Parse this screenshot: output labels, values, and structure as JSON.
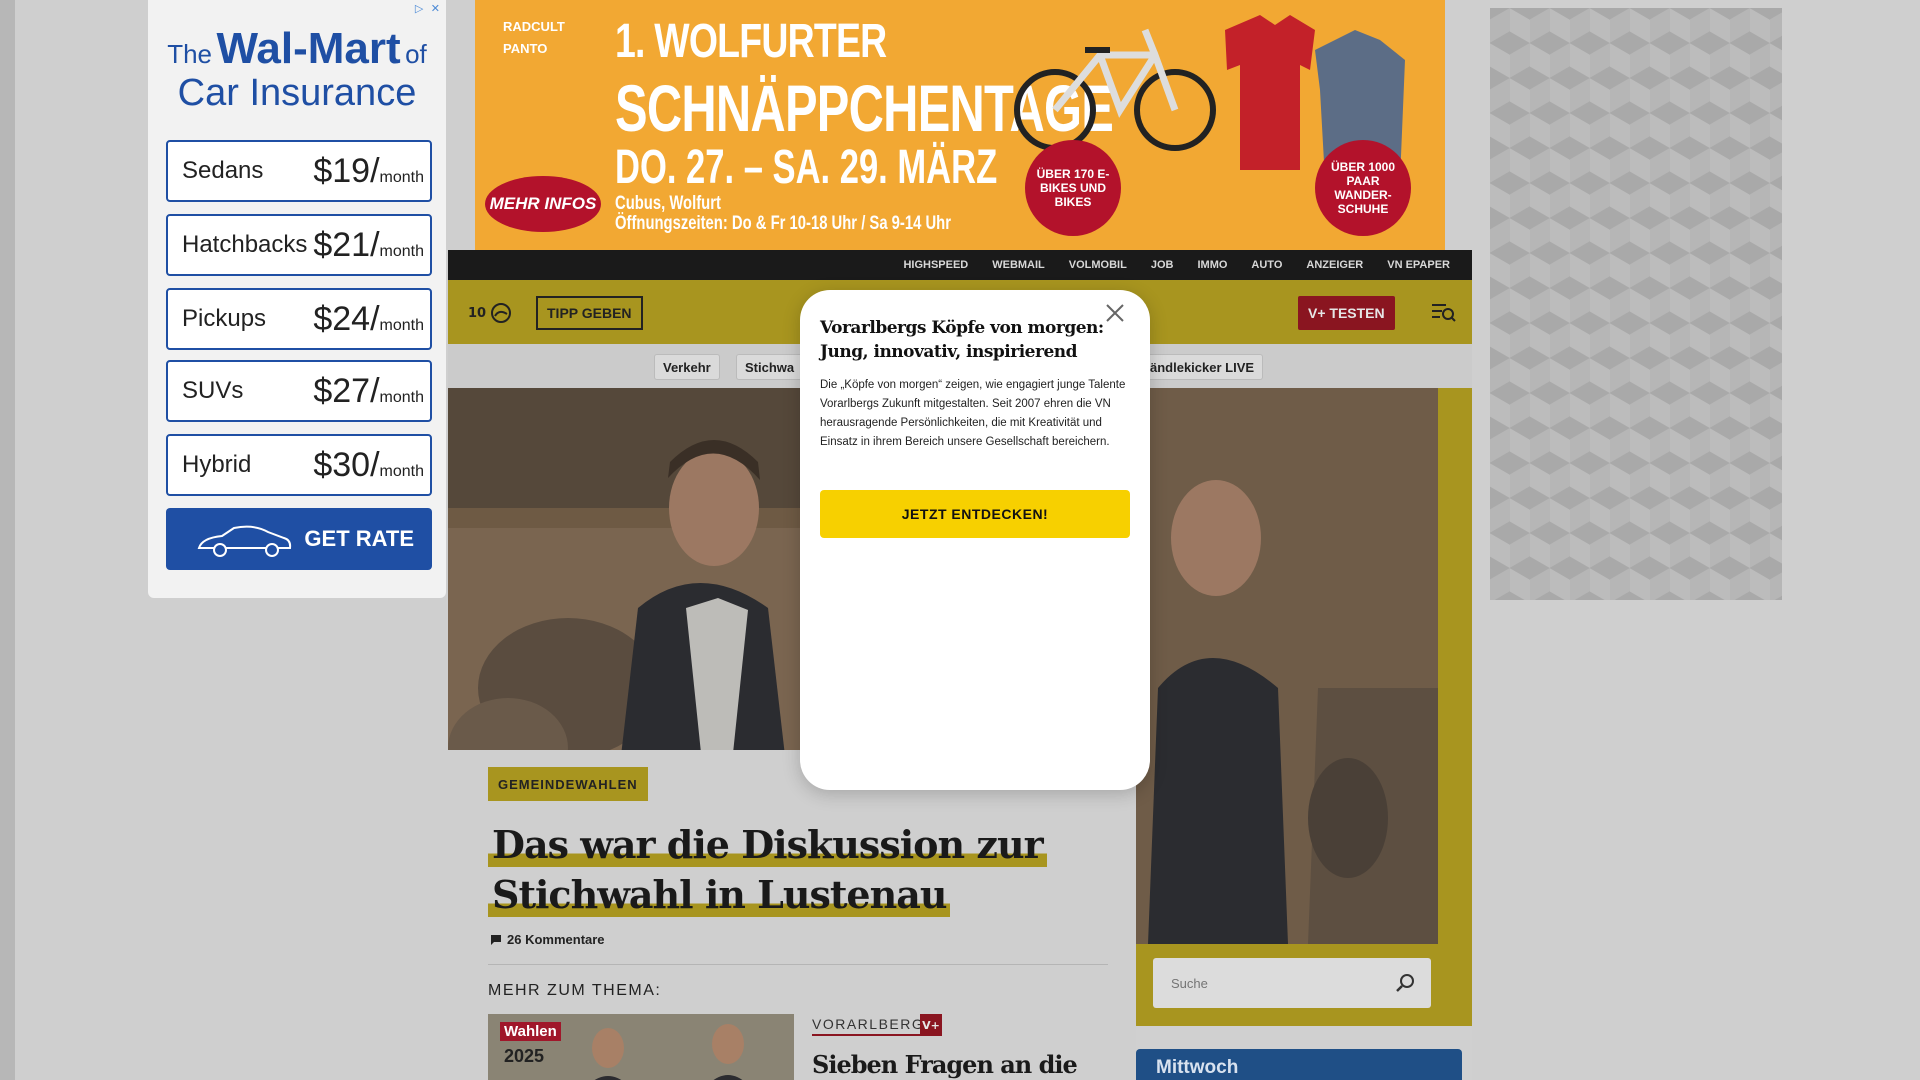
{
  "left_ad": {
    "adchoice": "▷ ✕",
    "headline_pre": "The",
    "headline_brand": "Wal-Mart",
    "headline_mid": "of",
    "headline_line2": "Car Insurance",
    "rows": [
      {
        "category": "Sedans",
        "price": "$19/",
        "unit": "month"
      },
      {
        "category": "Hatchbacks",
        "price": "$21/",
        "unit": "month"
      },
      {
        "category": "Pickups",
        "price": "$24/",
        "unit": "month"
      },
      {
        "category": "SUVs",
        "price": "$27/",
        "unit": "month"
      },
      {
        "category": "Hybrid",
        "price": "$30/",
        "unit": "month"
      }
    ],
    "cta": "GET RATE"
  },
  "top_ad": {
    "brand1": "RADCULT",
    "brand2": "PANTO",
    "line1": "1. WOLFURTER",
    "line2": "SCHNÄPPCHENTAGE",
    "line3": "DO. 27. – SA. 29. MÄRZ",
    "location": "Cubus, Wolfurt",
    "hours": "Öffnungszeiten: Do & Fr 10-18 Uhr / Sa 9-14 Uhr",
    "mehr_infos": "MEHR INFOS",
    "badge1": "ÜBER 170 E-BIKES UND BIKES",
    "badge2": "ÜBER 1000 PAAR WANDER-SCHUHE"
  },
  "topnav": [
    "HIGHSPEED",
    "WEBMAIL",
    "VOLMOBIL",
    "JOB",
    "IMMO",
    "AUTO",
    "ANZEIGER",
    "VN EPAPER"
  ],
  "header": {
    "weather_temp": "10",
    "tipp_label": "TIPP GEBEN",
    "vplus_label": "V+ TESTEN"
  },
  "subnav": {
    "chip1": "Verkehr",
    "chip2": "Stichwa",
    "chip3": "ändlekicker LIVE"
  },
  "article": {
    "tag": "GEMEINDEWAHLEN",
    "headline_line1": "Das war die Diskussion zur",
    "headline_line2": "Stichwahl in Lustenau",
    "comments": "26 Kommentare",
    "more_label": "MEHR ZUM THEMA:",
    "related_thumb_label": "Wahlen",
    "related_thumb_year": "2025",
    "related_category": "VORARLBERG",
    "related_vplus": "V+",
    "related_title": "Sieben Fragen an die"
  },
  "sidebar": {
    "search_placeholder": "Suche",
    "weather_day": "Mittwoch"
  },
  "modal": {
    "title": "Vorarlbergs Köpfe von morgen: Jung, innovativ, inspirierend",
    "body": "Die „Köpfe von morgen“ zeigen, wie engagiert junge Talente Vorarlbergs Zukunft mitgestalten. Seit 2007 ehren die VN herausragende Persönlichkeiten, die mit Kreativität und Einsatz in ihrem Bereich unsere Gesellschaft bereichern.",
    "cta": "JETZT ENTDECKEN!"
  },
  "colors": {
    "site_yellow": "#f7d000",
    "vplus_red": "#c8102e",
    "ad_blue": "#1f4fa4",
    "ad_orange": "#f2a833"
  }
}
